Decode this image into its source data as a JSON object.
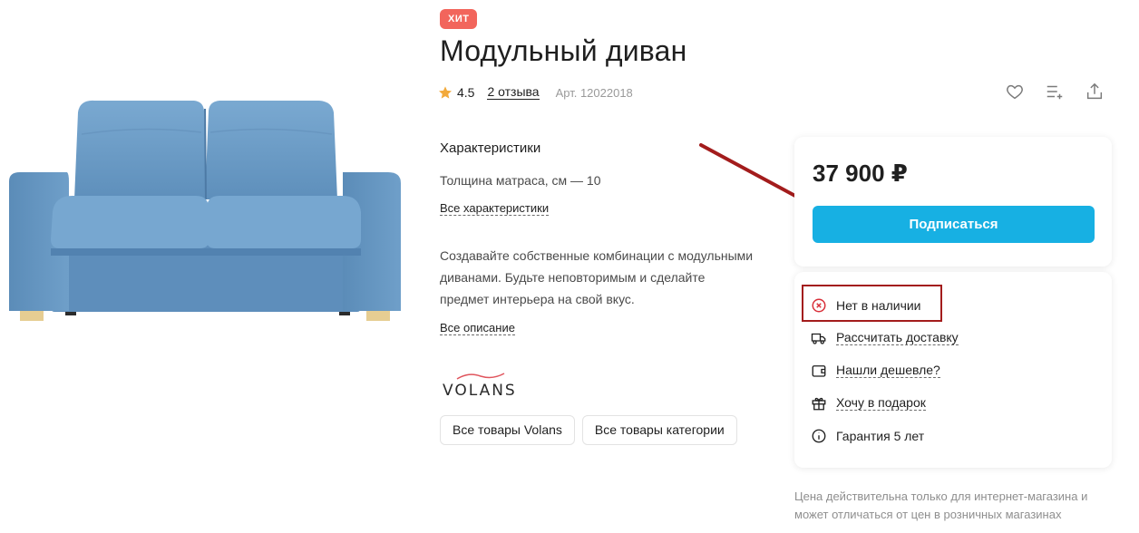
{
  "product": {
    "badge": "ХИТ",
    "title": "Модульный диван",
    "rating": "4.5",
    "reviews_link": "2 отзыва",
    "article": "Арт. 12022018",
    "image_alt": "sofa"
  },
  "actions": [
    {
      "name": "favorite",
      "icon": "heart-icon"
    },
    {
      "name": "compare",
      "icon": "compare-list-icon"
    },
    {
      "name": "share",
      "icon": "share-icon"
    }
  ],
  "specs": {
    "heading": "Характеристики",
    "line": "Толщина матраса, см — 10",
    "all_link": "Все характеристики"
  },
  "description": {
    "text": "Создавайте собственные комбинации с модульными диванами. Будьте неповторимым и сделайте предмет интерьера на свой вкус.",
    "all_link": "Все описание"
  },
  "brand": {
    "name": "VOLANS",
    "chips": [
      "Все товары Volans",
      "Все товары категории"
    ]
  },
  "price_card": {
    "price": "37 900 ₽",
    "subscribe_label": "Подписаться",
    "button_color": "#17b0e3"
  },
  "info_card": {
    "stock": "Нет в наличии",
    "delivery": "Рассчитать доставку",
    "cheaper": "Нашли дешевле?",
    "gift": "Хочу в подарок",
    "warranty": "Гарантия 5 лет"
  },
  "footnote": "Цена действительна только для интернет-магазина и может отличаться от цен в розничных магазинах",
  "colors": {
    "badge": "#f2655c",
    "accent_button": "#17b0e3",
    "annotation": "#a31c1c",
    "sofa": "#6a9dc7"
  }
}
